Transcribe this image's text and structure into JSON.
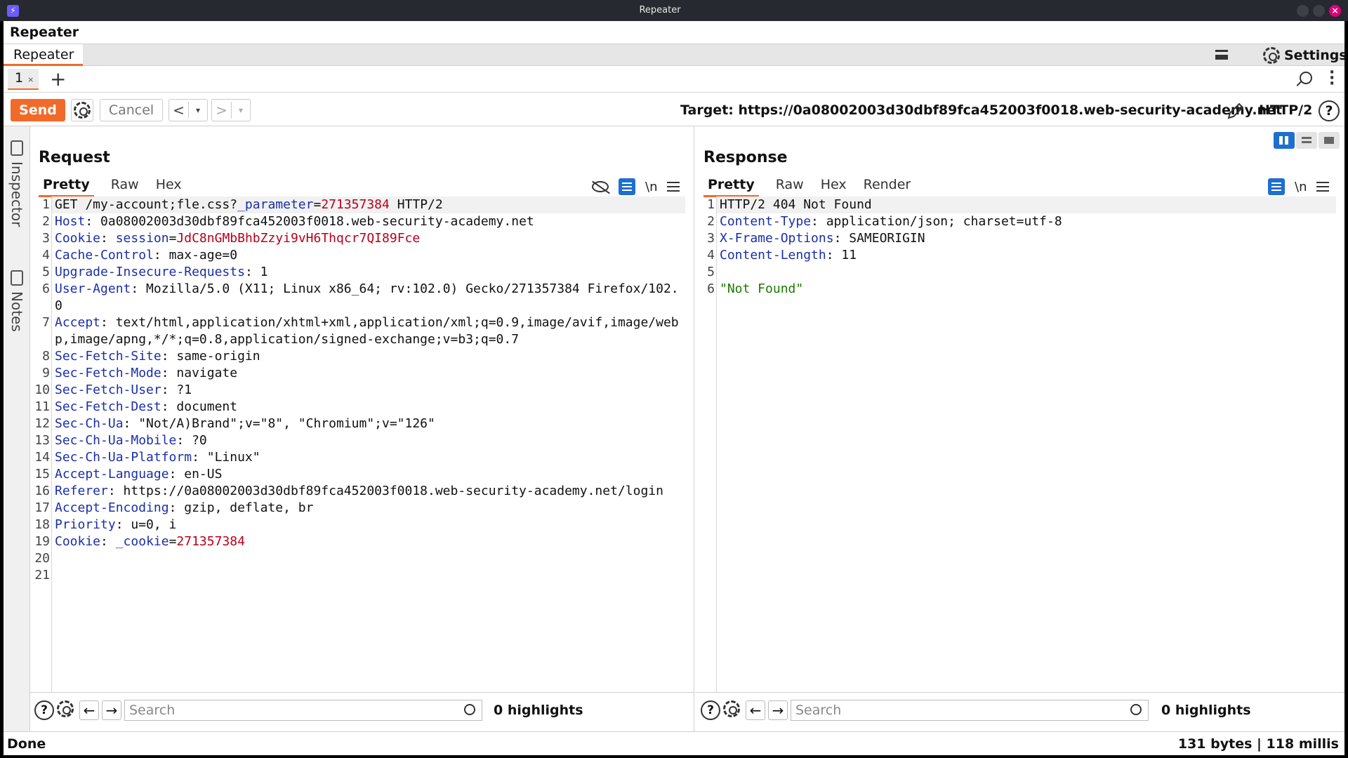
{
  "window": {
    "title": "Repeater"
  },
  "header": {
    "title": "Repeater"
  },
  "tool_tabs": {
    "active": "Repeater",
    "settings_label": "Settings"
  },
  "request_tabs": {
    "tab1": "1",
    "close": "×",
    "add": "+"
  },
  "toolbar": {
    "send_label": "Send",
    "cancel_label": "Cancel",
    "back": "<",
    "forward": ">",
    "dropdown": "▾",
    "target": "Target: https://0a08002003d30dbf89fca452003f0018.web-security-academy.net",
    "protocol": "HTTP/2",
    "help": "?"
  },
  "sidebar": {
    "inspector": "Inspector",
    "notes": "Notes"
  },
  "request": {
    "title": "Request",
    "tabs": [
      "Pretty",
      "Raw",
      "Hex"
    ],
    "newline_label": "\\n",
    "lines": [
      [
        {
          "t": "GET /my-account;fle.css?"
        },
        {
          "t": "_parameter",
          "c": "k"
        },
        {
          "t": "="
        },
        {
          "t": "271357384",
          "c": "v"
        },
        {
          "t": " HTTP/2"
        }
      ],
      [
        {
          "t": "Host",
          "c": "k"
        },
        {
          "t": ": 0a08002003d30dbf89fca452003f0018.web-security-academy.net"
        }
      ],
      [
        {
          "t": "Cookie",
          "c": "k"
        },
        {
          "t": ": "
        },
        {
          "t": "session",
          "c": "k"
        },
        {
          "t": "="
        },
        {
          "t": "JdC8nGMbBhbZzyi9vH6Thqcr7QI89Fce",
          "c": "v"
        }
      ],
      [
        {
          "t": "Cache-Control",
          "c": "k"
        },
        {
          "t": ": max-age=0"
        }
      ],
      [
        {
          "t": "Upgrade-Insecure-Requests",
          "c": "k"
        },
        {
          "t": ": 1"
        }
      ],
      [
        {
          "t": "User-Agent",
          "c": "k"
        },
        {
          "t": ": Mozilla/5.0 (X11; Linux x86_64; rv:102.0) Gecko/271357384 Firefox/102.0"
        }
      ],
      [
        {
          "t": "Accept",
          "c": "k"
        },
        {
          "t": ": text/html,application/xhtml+xml,application/xml;q=0.9,image/avif,image/webp,image/apng,*/*;q=0.8,application/signed-exchange;v=b3;q=0.7"
        }
      ],
      [
        {
          "t": "Sec-Fetch-Site",
          "c": "k"
        },
        {
          "t": ": same-origin"
        }
      ],
      [
        {
          "t": "Sec-Fetch-Mode",
          "c": "k"
        },
        {
          "t": ": navigate"
        }
      ],
      [
        {
          "t": "Sec-Fetch-User",
          "c": "k"
        },
        {
          "t": ": ?1"
        }
      ],
      [
        {
          "t": "Sec-Fetch-Dest",
          "c": "k"
        },
        {
          "t": ": document"
        }
      ],
      [
        {
          "t": "Sec-Ch-Ua",
          "c": "k"
        },
        {
          "t": ": \"Not/A)Brand\";v=\"8\", \"Chromium\";v=\"126\""
        }
      ],
      [
        {
          "t": "Sec-Ch-Ua-Mobile",
          "c": "k"
        },
        {
          "t": ": ?0"
        }
      ],
      [
        {
          "t": "Sec-Ch-Ua-Platform",
          "c": "k"
        },
        {
          "t": ": \"Linux\""
        }
      ],
      [
        {
          "t": "Accept-Language",
          "c": "k"
        },
        {
          "t": ": en-US"
        }
      ],
      [
        {
          "t": "Referer",
          "c": "k"
        },
        {
          "t": ": https://0a08002003d30dbf89fca452003f0018.web-security-academy.net/login"
        }
      ],
      [
        {
          "t": "Accept-Encoding",
          "c": "k"
        },
        {
          "t": ": gzip, deflate, br"
        }
      ],
      [
        {
          "t": "Priority",
          "c": "k"
        },
        {
          "t": ": u=0, i"
        }
      ],
      [
        {
          "t": "Cookie",
          "c": "k"
        },
        {
          "t": ": "
        },
        {
          "t": "_cookie",
          "c": "k"
        },
        {
          "t": "="
        },
        {
          "t": "271357384",
          "c": "v"
        }
      ],
      [],
      []
    ],
    "search_placeholder": "Search",
    "highlights": "0 highlights"
  },
  "response": {
    "title": "Response",
    "tabs": [
      "Pretty",
      "Raw",
      "Hex",
      "Render"
    ],
    "newline_label": "\\n",
    "lines": [
      [
        {
          "t": "HTTP/2 404 Not Found"
        }
      ],
      [
        {
          "t": "Content-Type",
          "c": "k"
        },
        {
          "t": ": application/json; charset=utf-8"
        }
      ],
      [
        {
          "t": "X-Frame-Options",
          "c": "k"
        },
        {
          "t": ": SAMEORIGIN"
        }
      ],
      [
        {
          "t": "Content-Length",
          "c": "k"
        },
        {
          "t": ": 11"
        }
      ],
      [],
      [
        {
          "t": "\"Not Found\"",
          "c": "s"
        }
      ]
    ],
    "search_placeholder": "Search",
    "highlights": "0 highlights"
  },
  "status": {
    "left": "Done",
    "right": "131 bytes | 118 millis"
  },
  "colors": {
    "accent": "#f26a2a",
    "key": "#1a2fa8",
    "value": "#b8001a",
    "string": "#1a7a00",
    "toggle": "#1f6fd0"
  }
}
